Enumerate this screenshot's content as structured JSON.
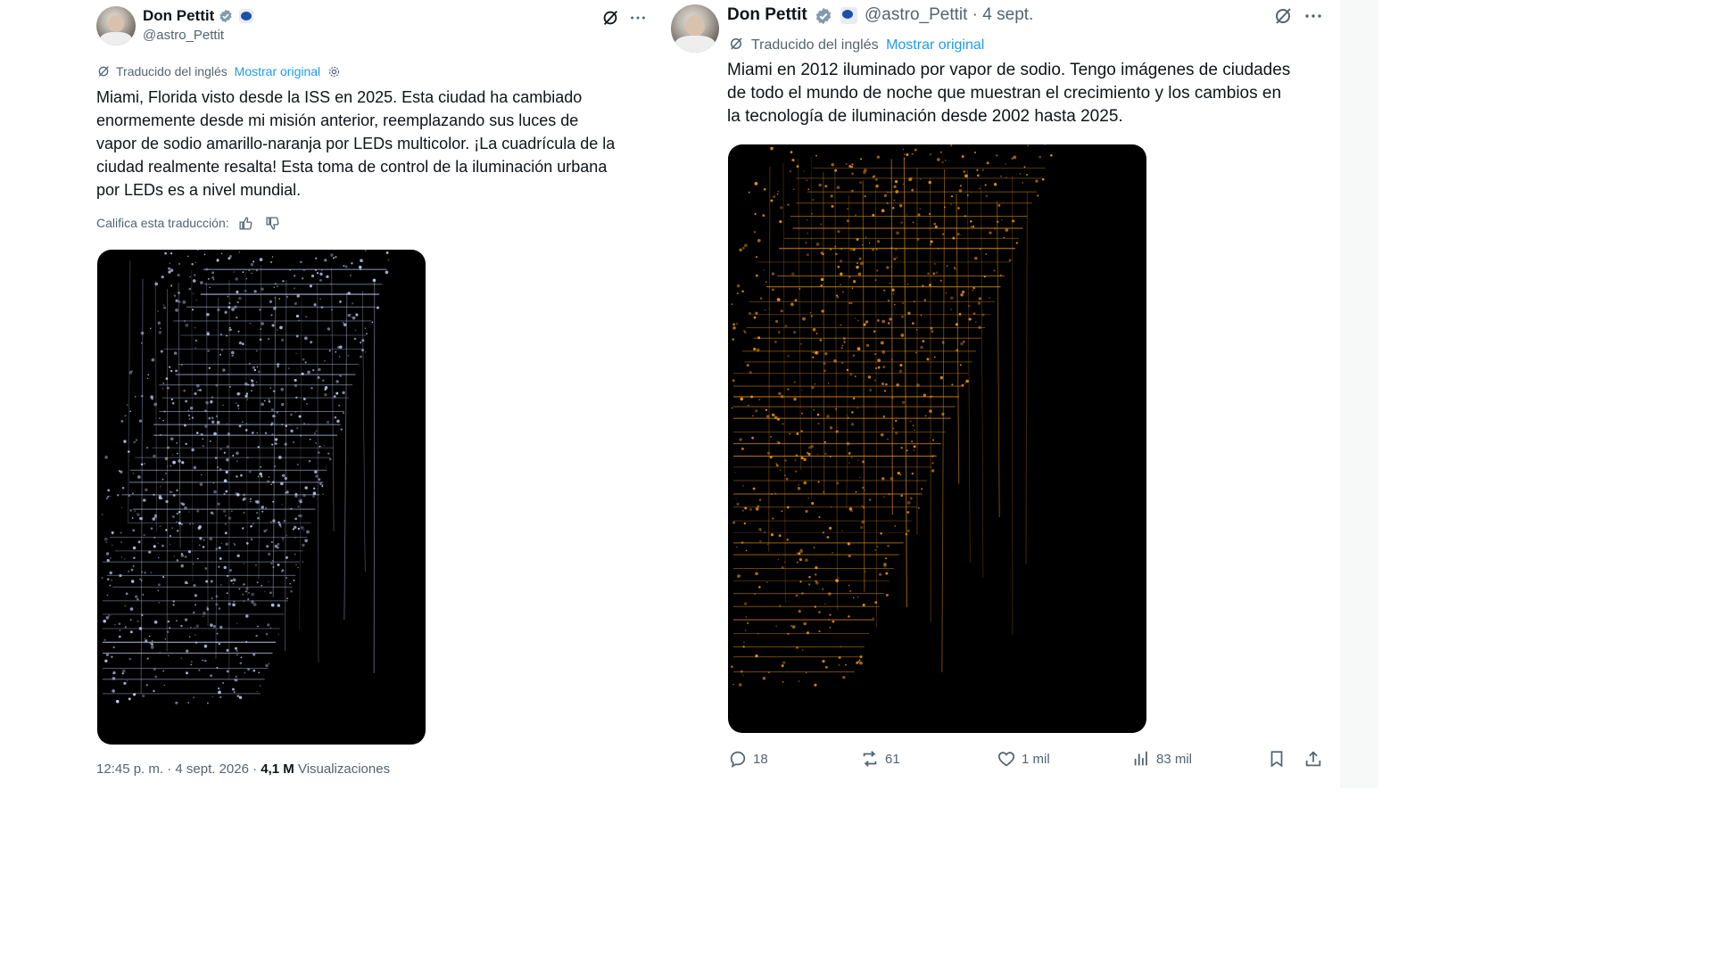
{
  "left": {
    "author": {
      "name": "Don Pettit",
      "handle": "@astro_Pettit"
    },
    "translation": {
      "label": "Traducido del inglés",
      "show_original": "Mostrar original"
    },
    "text": "Miami, Florida visto desde la ISS en 2025. Esta ciudad ha cambiado\nenormemente desde mi misión anterior, reemplazando sus luces de\nvapor de sodio amarillo-naranja por LEDs multicolor. ¡La cuadrícula de la\nciudad realmente resalta! Esta toma de control de la iluminación urbana\npor LEDs es a nivel mundial.",
    "rate": "Califica esta traducción:",
    "meta": {
      "time": "12:45 p. m. · 4 sept. 2026 ·",
      "views_count": "4,1 M",
      "views_label": "Visualizaciones"
    }
  },
  "right": {
    "author": {
      "name": "Don Pettit",
      "handle_date": "@astro_Pettit · 4 sept."
    },
    "translation": {
      "label": "Traducido del inglés",
      "show_original": "Mostrar original"
    },
    "text": "Miami en 2012 iluminado por vapor de sodio. Tengo imágenes de ciudades\nde todo el mundo de noche que muestran el crecimiento y los cambios en\nla tecnología de iluminación desde 2002 hasta 2025.",
    "actions": {
      "replies": "18",
      "reposts": "61",
      "likes": "1 mil",
      "views": "83 mil"
    }
  },
  "colors": {
    "link": "#1d9bf0",
    "secondary": "#536471",
    "verified": "#829aab",
    "led": "#c9d6ff",
    "sodium": "#ffa11a"
  }
}
